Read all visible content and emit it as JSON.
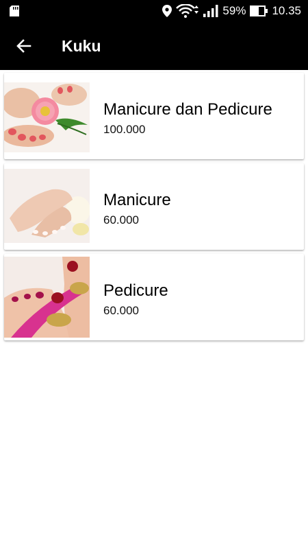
{
  "status_bar": {
    "battery_percent": "59%",
    "time": "10.35",
    "icons": [
      "sd-card-icon",
      "location-pin-icon",
      "wifi-icon",
      "signal-icon",
      "battery-icon"
    ]
  },
  "app_bar": {
    "back_icon": "arrow-left-icon",
    "title": "Kuku"
  },
  "services": [
    {
      "name": "Manicure dan Pedicure",
      "price": "100.000",
      "image": "manicure-pedicure-image"
    },
    {
      "name": "Manicure",
      "price": "60.000",
      "image": "manicure-image"
    },
    {
      "name": "Pedicure",
      "price": "60.000",
      "image": "pedicure-image"
    }
  ],
  "colors": {
    "app_bar": "#000000",
    "background": "#ffffff",
    "text": "#000000"
  }
}
